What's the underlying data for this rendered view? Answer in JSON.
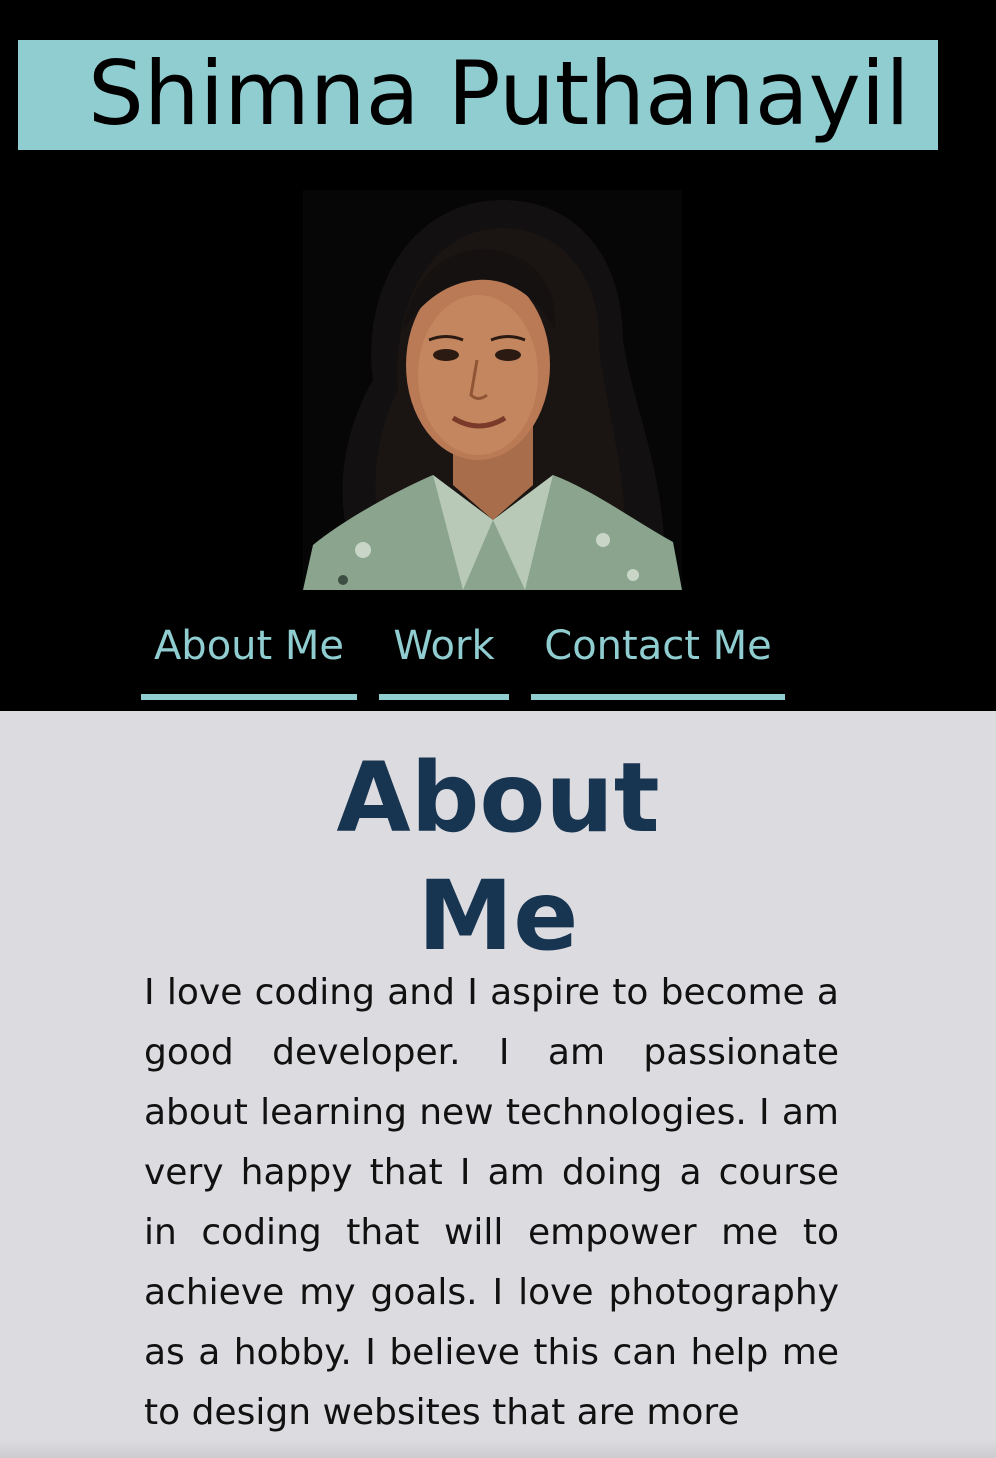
{
  "header": {
    "name": "Shimna Puthanayil",
    "banner_color": "#8fcdd0",
    "background": "#000000"
  },
  "portrait": {
    "subject": "portrait-photo"
  },
  "nav": {
    "items": [
      {
        "label": "About Me"
      },
      {
        "label": "Work"
      },
      {
        "label": "Contact Me"
      }
    ],
    "accent": "#8fcdd0"
  },
  "about": {
    "title_line1": "About",
    "title_line2": "Me",
    "title_color": "#173451",
    "body": "I love coding and I aspire to become a good developer. I am passionate about learning new technologies. I am very happy that I am doing a course in coding that will empower me to achieve my goals. I love photography as a hobby. I believe this can help me to design websites that are more"
  }
}
